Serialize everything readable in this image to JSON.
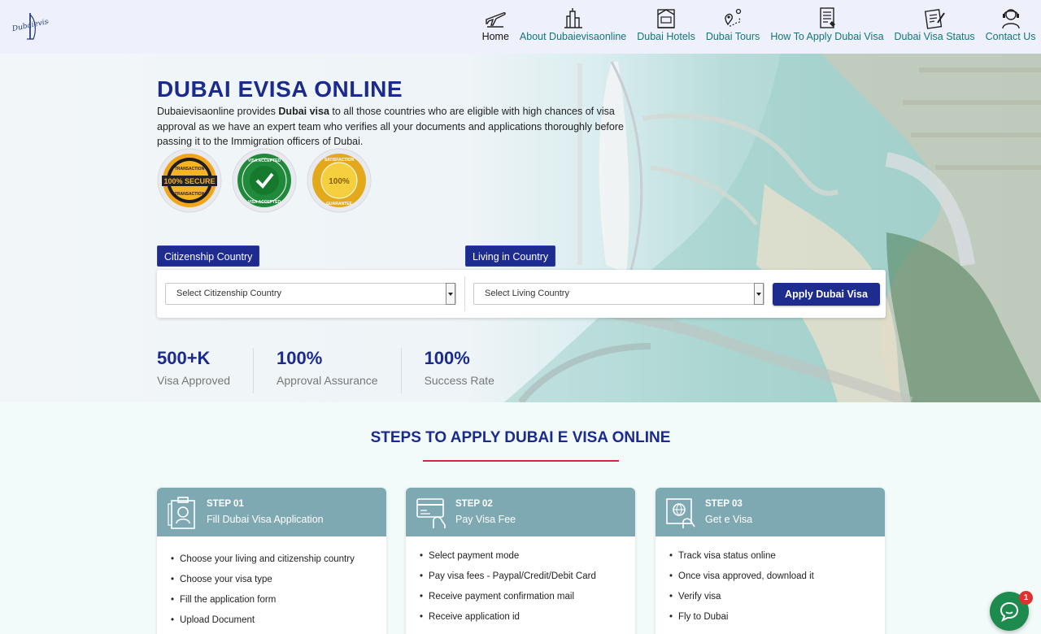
{
  "header": {
    "logo_text": "Dubaievisaonline",
    "nav": [
      {
        "label": "Home",
        "icon": "plane-icon",
        "active": true
      },
      {
        "label": "About Dubaievisaonline",
        "icon": "city-icon"
      },
      {
        "label": "Dubai Hotels",
        "icon": "hotel-icon"
      },
      {
        "label": "Dubai Tours",
        "icon": "map-pin-icon"
      },
      {
        "label": "How To Apply Dubai Visa",
        "icon": "document-icon"
      },
      {
        "label": "Dubai Visa Status",
        "icon": "clipboard-icon"
      },
      {
        "label": "Contact Us",
        "icon": "support-agent-icon"
      }
    ]
  },
  "hero": {
    "title": "DUBAI EVISA ONLINE",
    "desc_pre": "Dubaievisaonline provides ",
    "desc_bold": "Dubai visa",
    "desc_post": " to all those countries who are eligible with high chances of visa approval as we have an expert team who verifies all your documents and applications thoroughly before passing it to the Immigration officers of Dubai.",
    "badges": [
      {
        "name": "secure-badge",
        "top": "TRANSACTION",
        "mid": "100% SECURE",
        "bottom": "TRANSACTION"
      },
      {
        "name": "visa-accepted-badge",
        "top": "VISA ACCEPTED",
        "bottom": "VISA ACCEPTED"
      },
      {
        "name": "satisfaction-badge",
        "top": "SATISFACTION",
        "mid": "100%",
        "bottom": "GUARANTEE"
      }
    ]
  },
  "search": {
    "citizen_tag": "Citizenship Country",
    "living_tag": "Living in Country",
    "citizen_placeholder": "Select Citizenship Country",
    "living_placeholder": "Select Living Country",
    "apply_label": "Apply Dubai Visa"
  },
  "stats": [
    {
      "value": "500+K",
      "label": "Visa Approved"
    },
    {
      "value": "100%",
      "label": "Approval Assurance"
    },
    {
      "value": "100%",
      "label": "Success Rate"
    }
  ],
  "steps": {
    "title": "STEPS TO APPLY DUBAI E VISA ONLINE",
    "cards": [
      {
        "num": "STEP 01",
        "name": "Fill Dubai Visa Application",
        "items": [
          "Choose your living and citizenship country",
          "Choose your visa type",
          "Fill the application form",
          "Upload Document"
        ]
      },
      {
        "num": "STEP 02",
        "name": "Pay Visa Fee",
        "items": [
          "Select payment mode",
          "Pay visa fees - Paypal/Credit/Debit Card",
          "Receive payment confirmation mail",
          "Receive application id"
        ]
      },
      {
        "num": "STEP 03",
        "name": "Get e Visa",
        "items": [
          "Track visa status online",
          "Once visa approved, download it",
          "Verify visa",
          "Fly to Dubai"
        ]
      }
    ]
  },
  "chat": {
    "badge_count": "1"
  },
  "colors": {
    "primary": "#1e2b8f",
    "teal": "#13747c",
    "step_header": "#7fa9b2",
    "accent_red": "#d6263a",
    "chat_green": "#1d8b4d"
  }
}
